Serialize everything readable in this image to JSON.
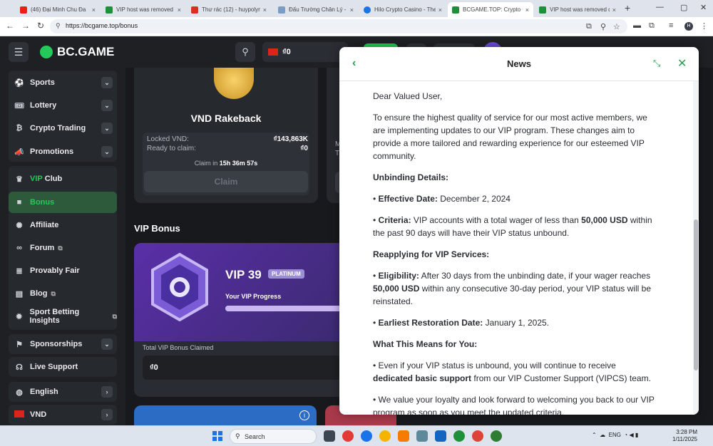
{
  "browser": {
    "tabs": [
      {
        "title": "(46) Đại Minh Chu Đa",
        "icon_color": "#e62117"
      },
      {
        "title": "VIP host was removed d",
        "icon_color": "#1f8f3a"
      },
      {
        "title": "Thư rác (12) - huypolym",
        "icon_color": "#d93025"
      },
      {
        "title": "Đấu Trường Chân Lý - Th",
        "icon_color": "#7a9cc6"
      },
      {
        "title": "Hilo Crypto Casino - The",
        "icon_color": "#1a73e8"
      },
      {
        "title": "BCGAME.TOP: Crypto Casi",
        "icon_color": "#1f8f3a"
      },
      {
        "title": "VIP host was removed d",
        "icon_color": "#1f8f3a"
      }
    ],
    "url": "https://bcgame.top/bonus",
    "profile_initial": "H"
  },
  "app": {
    "logo": "BC.GAME",
    "balance": "₫0"
  },
  "sidebar": {
    "group1": [
      {
        "label": "Sports",
        "icon": "sports-icon",
        "glyph": "⚽"
      },
      {
        "label": "Lottery",
        "icon": "lottery-icon",
        "glyph": "🎟"
      },
      {
        "label": "Crypto Trading",
        "icon": "crypto-trading-icon",
        "glyph": "₿"
      },
      {
        "label": "Promotions",
        "icon": "promotions-icon",
        "glyph": "📣"
      }
    ],
    "vip_prefix": "VIP",
    "vip_suffix": " Club",
    "group2": [
      {
        "label": "Bonus",
        "icon": "gift-icon",
        "glyph": "🎁"
      },
      {
        "label": "Affiliate",
        "icon": "affiliate-icon",
        "glyph": "⚙"
      },
      {
        "label": "Forum",
        "icon": "forum-icon",
        "glyph": "👥"
      },
      {
        "label": "Provably Fair",
        "icon": "provably-fair-icon",
        "glyph": "⚖"
      },
      {
        "label": "Blog",
        "icon": "blog-icon",
        "glyph": "💬"
      },
      {
        "label": "Sport Betting Insights",
        "icon": "insights-icon",
        "glyph": "⚙"
      }
    ],
    "sponsorships": "Sponsorships",
    "live_support": "Live Support",
    "language": "English",
    "currency": "VND"
  },
  "rakeback": {
    "title": "VND Rakeback",
    "locked_label": "Locked VND:",
    "locked_value": "₫143,863K",
    "ready_label": "Ready to claim:",
    "ready_value": "₫0",
    "claim_in_prefix": "Claim in ",
    "claim_in_time": "15h 36m 57s",
    "claim_button": "Claim"
  },
  "card2": {
    "m": "M",
    "t": "T"
  },
  "vip_bonus": {
    "section_title": "VIP Bonus",
    "level": "VIP 39",
    "tier": "PLATINUM",
    "progress_label": "Your VIP Progress",
    "progress": 0.9,
    "total_label": "Total VIP Bonus Claimed",
    "total_value": "₫0"
  },
  "news": {
    "title": "News",
    "greeting": "Dear Valued User,",
    "intro": "To ensure the highest quality of service for our most active members, we are implementing updates to our VIP program. These changes aim to provide a more tailored and rewarding experience for our esteemed VIP community.",
    "unbinding_heading": "Unbinding Details:",
    "effective_label": "Effective Date:",
    "effective_value": " December 2, 2024",
    "criteria_label": "Criteria:",
    "criteria_text1": " VIP accounts with a total wager of less than ",
    "criteria_amount": "50,000 USD",
    "criteria_text2": " within the past 90 days will have their VIP status unbound.",
    "reapply_heading": "Reapplying for VIP Services:",
    "eligibility_label": "Eligibility:",
    "eligibility_text1": " After 30 days from the unbinding date, if your wager reaches ",
    "eligibility_amount": "50,000 USD",
    "eligibility_text2": " within any consecutive 30-day period, your VIP status will be reinstated.",
    "earliest_label": "Earliest Restoration Date:",
    "earliest_value": " January 1, 2025.",
    "meaning_heading": "What This Means for You:",
    "meaning1_text1": "Even if your VIP status is unbound, you will continue to receive ",
    "meaning1_bold": "dedicated basic support",
    "meaning1_text2": " from our VIP Customer Support (VIPCS) team.",
    "meaning2": "We value your loyalty and look forward to welcoming you back to our VIP program as soon as you meet the updated criteria.",
    "bullet": "• "
  },
  "taskbar": {
    "search_placeholder": "Search",
    "lang": "ENG",
    "time": "3:28 PM",
    "date": "1/11/2025"
  },
  "colors": {
    "accent": "#24c95a",
    "sidebar_bg": "#1e2024",
    "modal_bg": "#ffffff"
  }
}
